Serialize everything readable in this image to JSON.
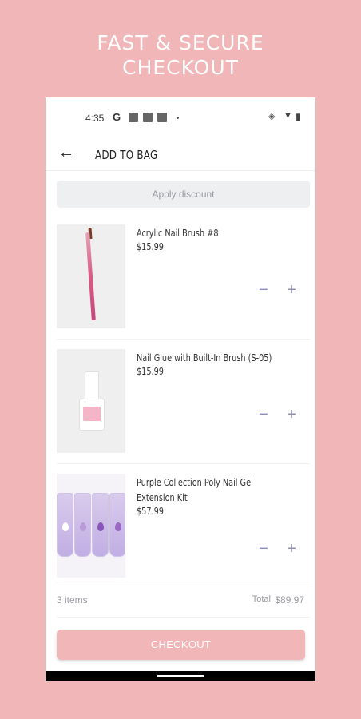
{
  "promo": {
    "line1": "FAST & SECURE",
    "line2": "CHECKOUT"
  },
  "status_bar": {
    "time": "4:35",
    "g": "G"
  },
  "app_bar": {
    "title": "ADD TO BAG"
  },
  "discount": {
    "label": "Apply discount"
  },
  "items": [
    {
      "name": "Acrylic Nail Brush #8",
      "price": "$15.99"
    },
    {
      "name": "Nail Glue with Built-In Brush (S-05)",
      "price": "$15.99"
    },
    {
      "name": "Purple Collection Poly Nail Gel Extension Kit",
      "price": "$57.99"
    }
  ],
  "summary": {
    "count": "3 items",
    "total_label": "Total",
    "total_value": "$89.97"
  },
  "checkout": {
    "label": "CHECKOUT"
  },
  "icons": {
    "back": "arrow-left-icon",
    "minus": "minus-icon",
    "plus": "plus-icon"
  },
  "colors": {
    "background": "#f0b6b8",
    "accent": "#8e8fbe",
    "button": "#f0b6b8"
  }
}
